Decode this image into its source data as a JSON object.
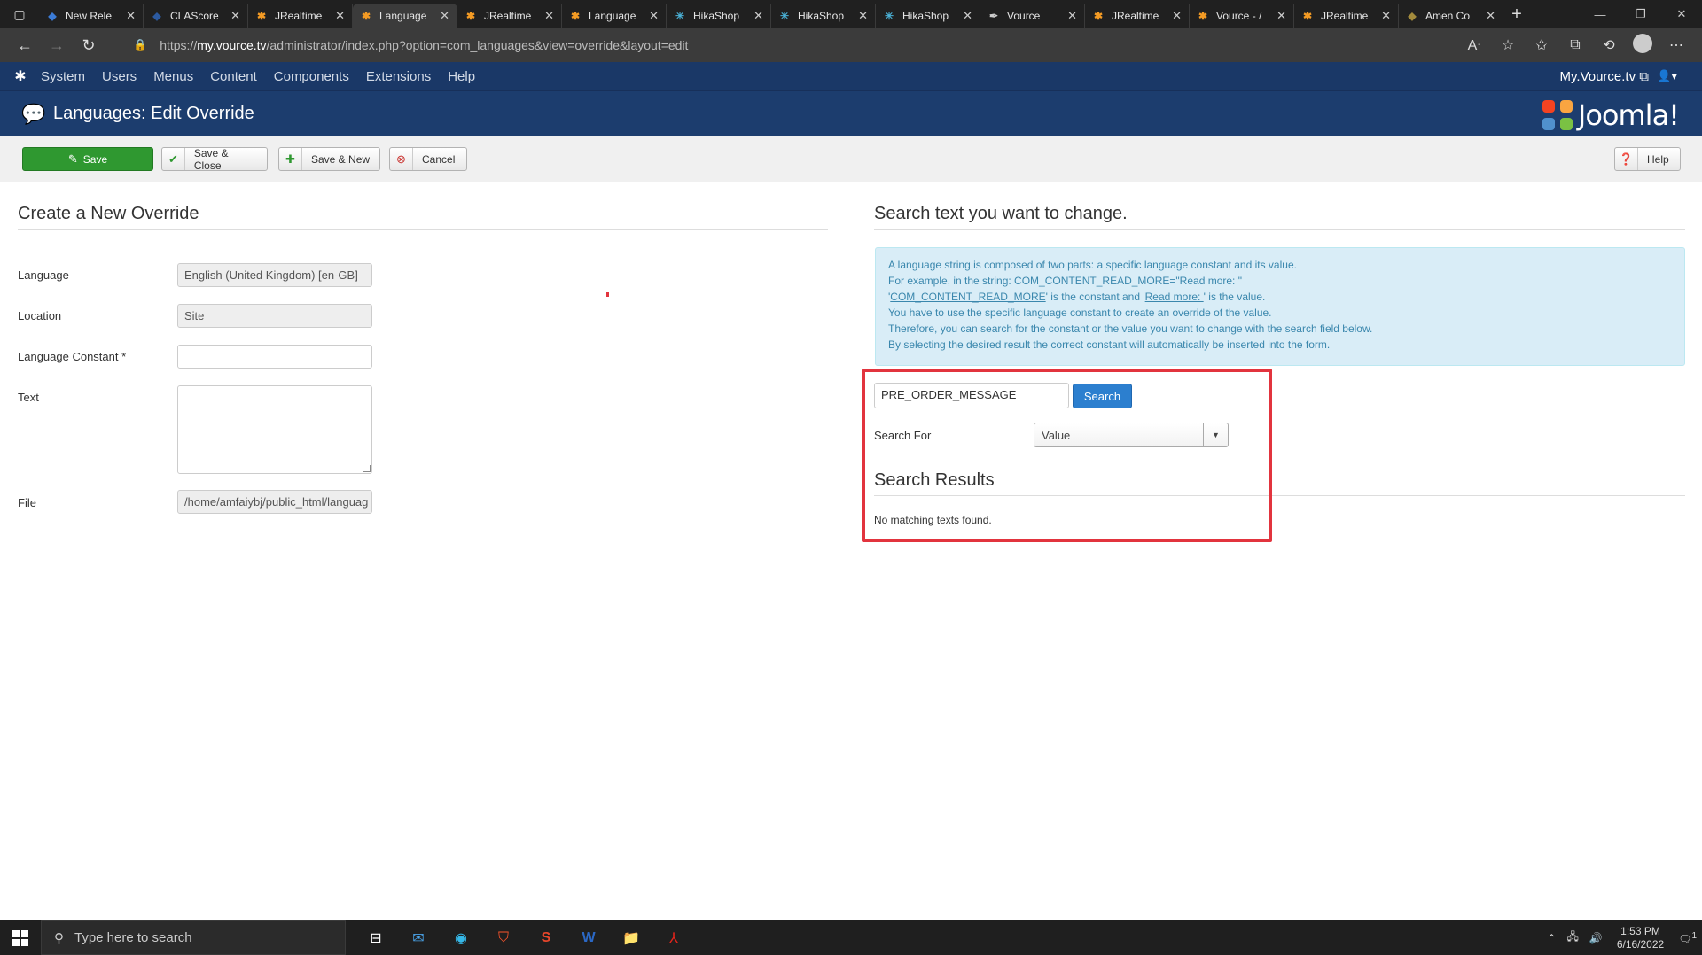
{
  "browser": {
    "tabs": [
      {
        "title": "New Rele",
        "icon": "diamond-icon",
        "color": "#3b7bd6"
      },
      {
        "title": "CLAScore",
        "icon": "diamond-icon",
        "color": "#2c5aa0"
      },
      {
        "title": "JRealtime",
        "icon": "joomla-icon",
        "color": "#f49b24"
      },
      {
        "title": "Language",
        "icon": "joomla-icon",
        "color": "#f49b24",
        "active": true
      },
      {
        "title": "JRealtime",
        "icon": "joomla-icon",
        "color": "#f49b24"
      },
      {
        "title": "Language",
        "icon": "joomla-icon",
        "color": "#f49b24"
      },
      {
        "title": "HikaShop",
        "icon": "star-icon",
        "color": "#4ab1d6"
      },
      {
        "title": "HikaShop",
        "icon": "star-icon",
        "color": "#4ab1d6"
      },
      {
        "title": "HikaShop",
        "icon": "star-icon",
        "color": "#4ab1d6"
      },
      {
        "title": "Vource",
        "icon": "pen-icon",
        "color": "#cccccc"
      },
      {
        "title": "JRealtime",
        "icon": "joomla-icon",
        "color": "#f49b24"
      },
      {
        "title": "Vource - /",
        "icon": "joomla-icon",
        "color": "#f49b24"
      },
      {
        "title": "JRealtime",
        "icon": "joomla-icon",
        "color": "#f49b24"
      },
      {
        "title": "Amen Co",
        "icon": "diamond-icon",
        "color": "#a38b3c"
      }
    ],
    "url_prefix": "https://",
    "url_host": "my.vource.tv",
    "url_path": "/administrator/index.php?option=com_languages&view=override&layout=edit"
  },
  "joomla_nav": {
    "menus": [
      "System",
      "Users",
      "Menus",
      "Content",
      "Components",
      "Extensions",
      "Help"
    ],
    "site_link": "My.Vource.tv"
  },
  "header": {
    "title": "Languages: Edit Override",
    "brand": "Joomla!"
  },
  "toolbar": {
    "save": "Save",
    "save_close": "Save & Close",
    "save_new": "Save & New",
    "cancel": "Cancel",
    "help": "Help"
  },
  "form": {
    "title": "Create a New Override",
    "language_label": "Language",
    "language_value": "English (United Kingdom) [en-GB]",
    "location_label": "Location",
    "location_value": "Site",
    "constant_label": "Language Constant *",
    "constant_value": "",
    "text_label": "Text",
    "file_label": "File",
    "file_value": "/home/amfaiybj/public_html/languag"
  },
  "search": {
    "title": "Search text you want to change.",
    "info_line1": "A language string is composed of two parts: a specific language constant and its value.",
    "info_line2": "For example, in the string: COM_CONTENT_READ_MORE=\"Read more: \"",
    "info_line3_pre": "'",
    "info_line3_const": "COM_CONTENT_READ_MORE",
    "info_line3_mid": "' is the constant and '",
    "info_line3_val": "Read more: ",
    "info_line3_post": "' is the value.",
    "info_line4": "You have to use the specific language constant to create an override of the value.",
    "info_line5": "Therefore, you can search for the constant or the value you want to change with the search field below.",
    "info_line6": "By selecting the desired result the correct constant will automatically be inserted into the form.",
    "query": "PRE_ORDER_MESSAGE",
    "button": "Search",
    "search_for_label": "Search For",
    "search_for_value": "Value",
    "results_title": "Search Results",
    "no_results": "No matching texts found."
  },
  "taskbar": {
    "search_placeholder": "Type here to search",
    "time": "1:53 PM",
    "date": "6/16/2022",
    "notification_count": "1"
  }
}
